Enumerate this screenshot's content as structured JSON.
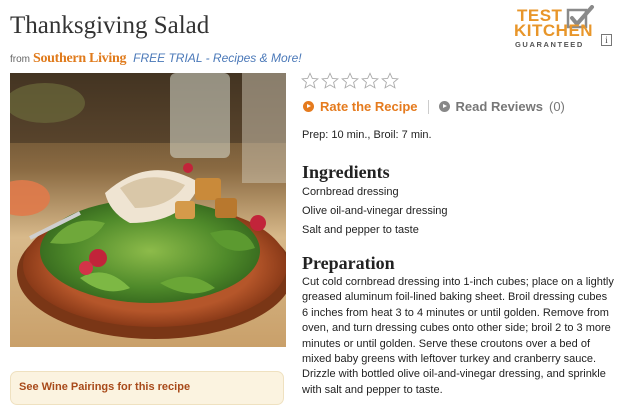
{
  "recipe": {
    "title": "Thanksgiving Salad",
    "from_label": "from",
    "source_brand": "Southern Living",
    "free_trial_link": "FREE TRIAL - Recipes & More!"
  },
  "badge": {
    "line1": "TEST",
    "line2": "KITCHEN",
    "line3": "GUARANTEED",
    "info": "i"
  },
  "rating": {
    "stars_filled": 0,
    "stars_total": 5,
    "rate_label": "Rate the Recipe",
    "reviews_label": "Read Reviews",
    "reviews_count": "(0)"
  },
  "times": "Prep: 10 min., Broil: 7 min.",
  "ingredients": {
    "heading": "Ingredients",
    "items": [
      "Cornbread dressing",
      "Olive oil-and-vinegar dressing",
      "Salt and pepper to taste"
    ]
  },
  "preparation": {
    "heading": "Preparation",
    "text": "Cut cold cornbread dressing into 1-inch cubes; place on a lightly greased aluminum foil-lined baking sheet. Broil dressing cubes 6 inches from heat 3 to 4 minutes or until golden. Remove from oven, and turn dressing cubes onto other side; broil 2 to 3 more minutes or until golden. Serve these croutons over a bed of mixed baby greens with leftover turkey and cranberry sauce. Drizzle with bottled olive oil-and-vinegar dressing, and sprinkle with salt and pepper to taste."
  },
  "wine": {
    "label": "See Wine Pairings for this recipe"
  },
  "colors": {
    "accent": "#e57b1e",
    "link": "#4a78b8",
    "wine_bg": "#fbf3e0",
    "wine_text": "#a84a1a"
  }
}
